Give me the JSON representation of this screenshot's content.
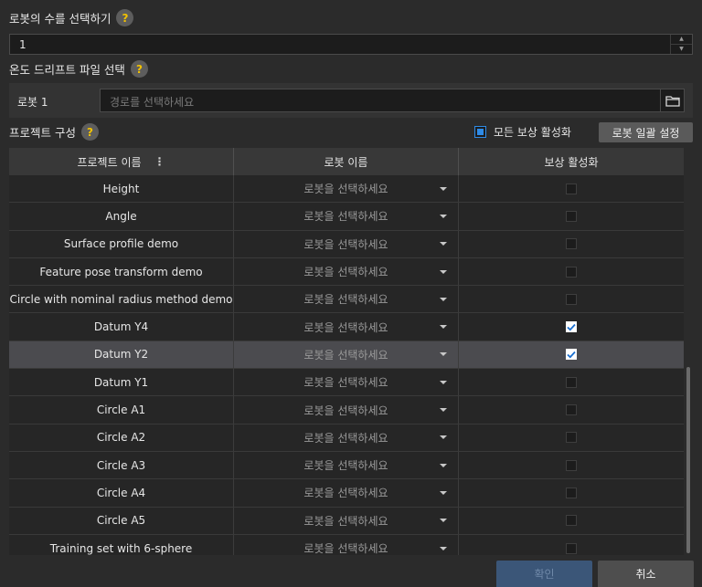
{
  "robot_count": {
    "label": "로봇의 수를 선택하기",
    "value": "1"
  },
  "temp_drift": {
    "label": "온도 드리프트 파일 선택",
    "robot_label": "로봇 1",
    "path_placeholder": "경로를 선택하세요"
  },
  "project_config": {
    "label": "프로젝트 구성",
    "enable_all_label": "모든 보상 활성화",
    "batch_button": "로봇 일괄 설정"
  },
  "table": {
    "headers": [
      "프로젝트 이름",
      "로봇 이름",
      "보상 활성화"
    ],
    "robot_placeholder": "로봇을 선택하세요",
    "rows": [
      {
        "name": "Height",
        "checked": false
      },
      {
        "name": "Angle",
        "checked": false
      },
      {
        "name": "Surface profile demo",
        "checked": false
      },
      {
        "name": "Feature pose transform demo",
        "checked": false
      },
      {
        "name": "Circle with nominal radius method demo",
        "checked": false
      },
      {
        "name": "Datum Y4",
        "checked": true
      },
      {
        "name": "Datum Y2",
        "checked": true,
        "selected": true
      },
      {
        "name": "Datum Y1",
        "checked": false
      },
      {
        "name": "Circle A1",
        "checked": false
      },
      {
        "name": "Circle A2",
        "checked": false
      },
      {
        "name": "Circle A3",
        "checked": false
      },
      {
        "name": "Circle A4",
        "checked": false
      },
      {
        "name": "Circle A5",
        "checked": false
      },
      {
        "name": "Training set with 6-sphere",
        "checked": false
      }
    ]
  },
  "footer": {
    "ok_label": "확인",
    "cancel_label": "취소"
  },
  "colors": {
    "accent": "#2f8be6",
    "background": "#2b2b2b",
    "selected_row": "#4b4b4f",
    "help_icon": "#f2c200"
  }
}
